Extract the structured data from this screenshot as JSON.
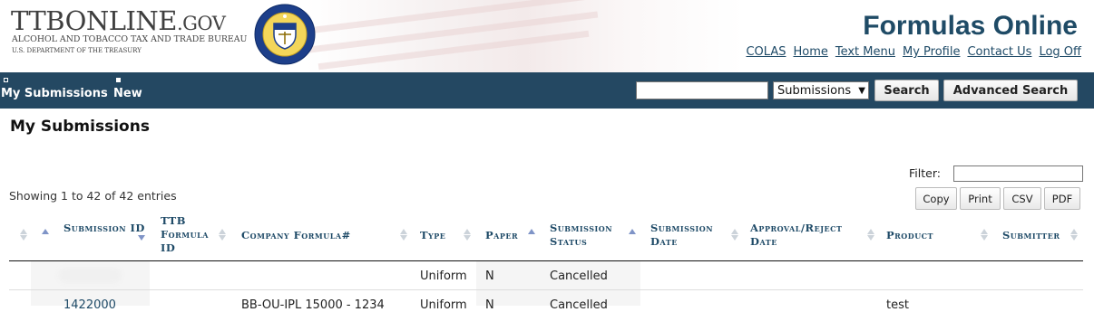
{
  "header": {
    "logo_text": "TTBONLINE",
    "logo_suffix": ".GOV",
    "agency_name": "ALCOHOL AND TOBACCO TAX AND TRADE BUREAU",
    "department": "U.S. DEPARTMENT OF THE TREASURY",
    "seal_text": "ALCOHOL AND TOBACCO TAX AND TRADE BUREAU",
    "app_title": "Formulas Online",
    "links": [
      "COLAS",
      "Home",
      "Text Menu",
      "My Profile",
      "Contact Us",
      "Log Off"
    ]
  },
  "nav": {
    "items": [
      "My Submissions",
      "New"
    ],
    "search_value": "",
    "search_scope": "Submissions",
    "search_button": "Search",
    "advanced_search_button": "Advanced Search"
  },
  "page": {
    "title": "My Submissions",
    "filter_label": "Filter:",
    "filter_value": "",
    "info_text": "Showing 1 to 42 of 42 entries",
    "export_buttons": [
      "Copy",
      "Print",
      "CSV",
      "PDF"
    ]
  },
  "table": {
    "columns": [
      {
        "label": "",
        "sort": "none"
      },
      {
        "label": "",
        "sort": "asc"
      },
      {
        "label": "Submission ID",
        "sort": "desc"
      },
      {
        "label": "TTB Formula ID",
        "sort": "none"
      },
      {
        "label": "Company Formula#",
        "sort": "none"
      },
      {
        "label": "Type",
        "sort": "none"
      },
      {
        "label": "Paper",
        "sort": "asc"
      },
      {
        "label": "Submission Status",
        "sort": "asc"
      },
      {
        "label": "Submission Date",
        "sort": "none"
      },
      {
        "label": "Approval/Reject Date",
        "sort": "none"
      },
      {
        "label": "Product",
        "sort": "none"
      },
      {
        "label": "Submitter",
        "sort": "none"
      }
    ],
    "rows": [
      {
        "submission_id": "",
        "ttb_formula_id": "",
        "company_formula": "",
        "type": "Uniform",
        "paper": "N",
        "status": "Cancelled",
        "submission_date": "",
        "approval_date": "",
        "product": "",
        "submitter": ""
      },
      {
        "submission_id": "1422000",
        "ttb_formula_id": "",
        "company_formula": "BB-OU-IPL 15000 - 1234",
        "type": "Uniform",
        "paper": "N",
        "status": "Cancelled",
        "submission_date": "",
        "approval_date": "",
        "product": "test",
        "submitter": ""
      }
    ]
  },
  "colors": {
    "navbar": "#244862",
    "link": "#1e4a67",
    "title": "#1f4b66"
  }
}
